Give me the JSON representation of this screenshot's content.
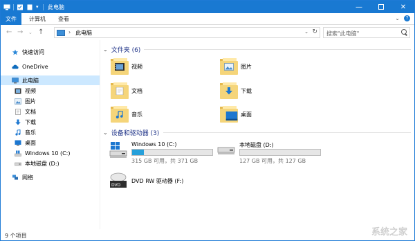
{
  "window": {
    "title": "此电脑"
  },
  "ribbon": {
    "tabs": [
      "文件",
      "计算机",
      "查看"
    ]
  },
  "address": {
    "path": "此电脑",
    "search_placeholder": "搜索\"此电脑\""
  },
  "nav": {
    "items": [
      {
        "label": "快速访问",
        "icon": "star-icon"
      },
      {
        "label": "OneDrive",
        "icon": "cloud-icon"
      },
      {
        "label": "此电脑",
        "icon": "computer-icon"
      },
      {
        "label": "视频",
        "icon": "video-icon"
      },
      {
        "label": "图片",
        "icon": "picture-icon"
      },
      {
        "label": "文档",
        "icon": "document-icon"
      },
      {
        "label": "下载",
        "icon": "download-icon"
      },
      {
        "label": "音乐",
        "icon": "music-icon"
      },
      {
        "label": "桌面",
        "icon": "desktop-icon"
      },
      {
        "label": "Windows 10 (C:)",
        "icon": "windows-drive-icon"
      },
      {
        "label": "本地磁盘 (D:)",
        "icon": "drive-icon"
      },
      {
        "label": "网络",
        "icon": "network-icon"
      }
    ]
  },
  "folders_section": {
    "title": "文件夹 (6)",
    "items": [
      {
        "label": "视频",
        "icon": "video-folder-icon"
      },
      {
        "label": "图片",
        "icon": "picture-folder-icon"
      },
      {
        "label": "文档",
        "icon": "document-folder-icon"
      },
      {
        "label": "下载",
        "icon": "download-folder-icon"
      },
      {
        "label": "音乐",
        "icon": "music-folder-icon"
      },
      {
        "label": "桌面",
        "icon": "desktop-folder-icon"
      }
    ]
  },
  "drives_section": {
    "title": "设备和驱动器 (3)",
    "items": [
      {
        "label": "Windows 10 (C:)",
        "capacity": "315 GB 可用，共 371 GB",
        "used_fraction": 0.15
      },
      {
        "label": "本地磁盘 (D:)",
        "capacity": "127 GB 可用，共 127 GB",
        "used_fraction": 0.0
      },
      {
        "label": "DVD RW 驱动器 (F:)"
      }
    ]
  },
  "status": {
    "count": "9 个项目"
  },
  "watermark": "系统之家",
  "colors": {
    "accent": "#1979d2",
    "selection": "#cce8ff",
    "header": "#1e3287",
    "drive_fill": "#26a0da"
  }
}
